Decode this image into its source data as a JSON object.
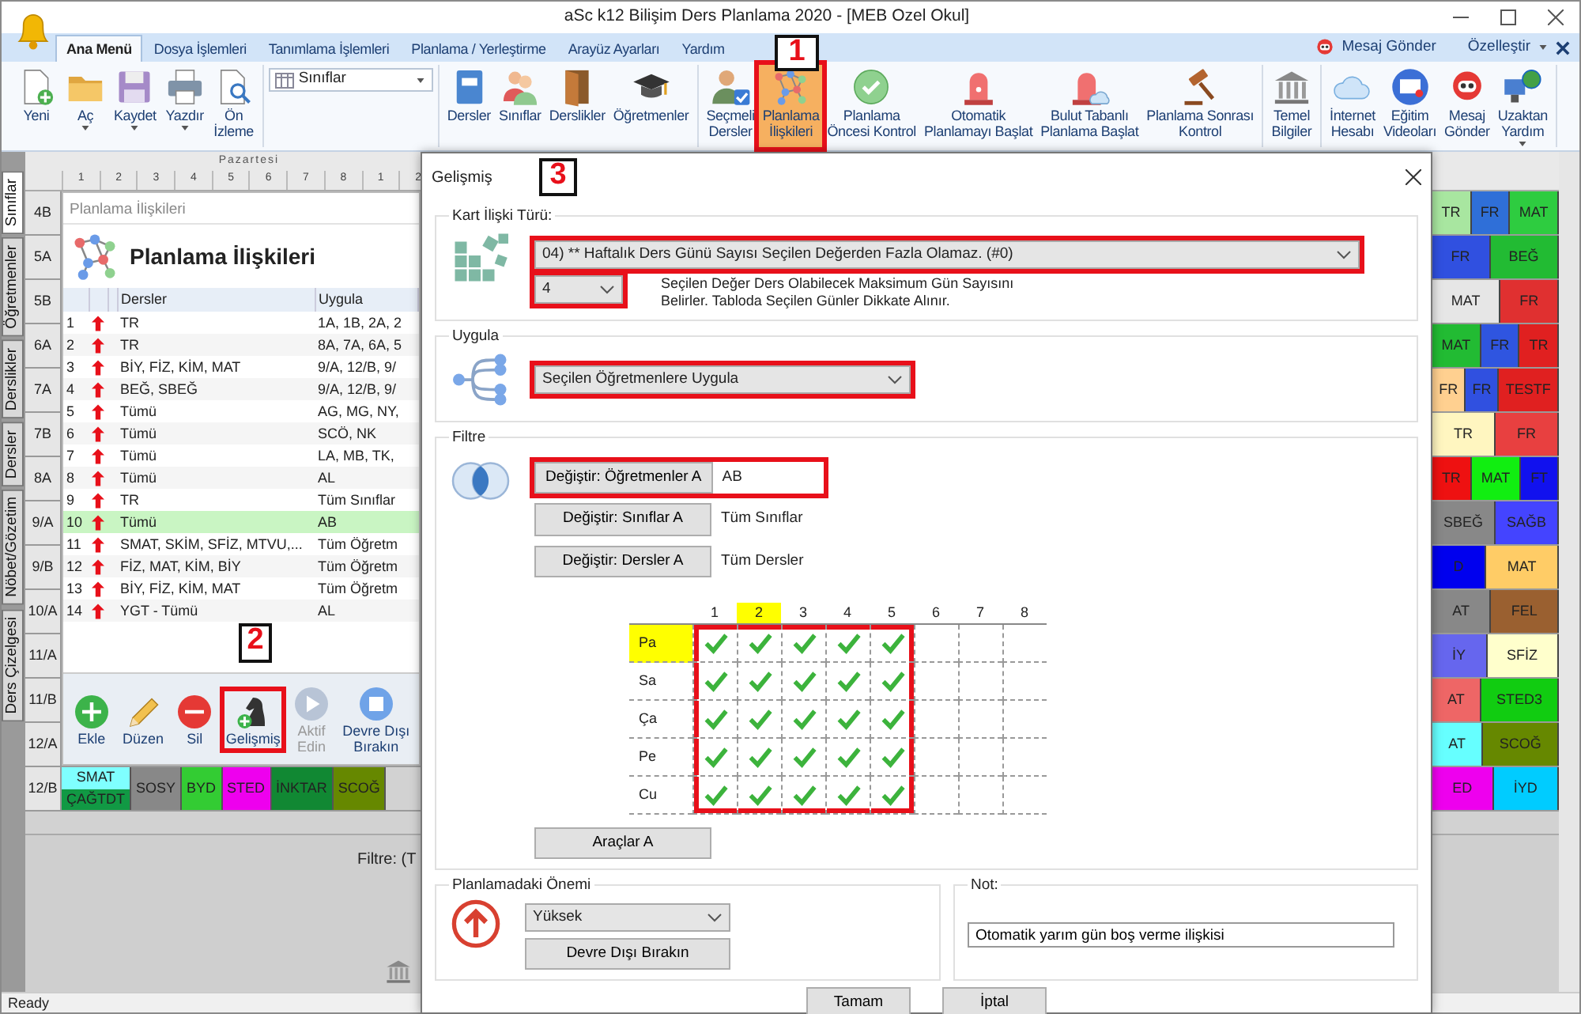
{
  "window": {
    "title": "aSc k12 Bilişim Ders Planlama 2020  - [MEB Ozel Okul]"
  },
  "menu_tabs": [
    {
      "label": "Ana Menü",
      "selected": true
    },
    {
      "label": "Dosya İşlemleri",
      "selected": false
    },
    {
      "label": "Tanımlama İşlemleri",
      "selected": false
    },
    {
      "label": "Planlama / Yerleştirme",
      "selected": false
    },
    {
      "label": "Arayüz Ayarları",
      "selected": false
    },
    {
      "label": "Yardım",
      "selected": false
    }
  ],
  "ribbon_extras": {
    "message": "Mesaj Gönder",
    "customize": "Özelleştir"
  },
  "ribbon": [
    {
      "kind": "buttons",
      "items": [
        {
          "label": "Yeni",
          "dropdown": false,
          "highlighted": false
        },
        {
          "label": "Aç",
          "dropdown": true,
          "highlighted": false
        },
        {
          "label": "Kaydet",
          "dropdown": true,
          "highlighted": false
        },
        {
          "label": "Yazdır",
          "dropdown": true,
          "highlighted": false
        },
        {
          "label": "Ön\nİzleme",
          "dropdown": false,
          "highlighted": false
        }
      ]
    },
    {
      "kind": "select",
      "value": "Sınıflar"
    },
    {
      "kind": "buttons",
      "items": [
        {
          "label": "Dersler",
          "dropdown": false,
          "highlighted": false
        },
        {
          "label": "Sınıflar",
          "dropdown": false,
          "highlighted": false
        },
        {
          "label": "Derslikler",
          "dropdown": false,
          "highlighted": false
        },
        {
          "label": "Öğretmenler",
          "dropdown": false,
          "highlighted": false
        }
      ]
    },
    {
      "kind": "buttons",
      "items": [
        {
          "label": "Seçmeli\nDersler",
          "dropdown": false,
          "highlighted": false
        },
        {
          "label": "Planlama\nİlişkileri",
          "dropdown": false,
          "highlighted": true
        },
        {
          "label": "Planlama\nÖncesi Kontrol",
          "dropdown": false,
          "highlighted": false
        },
        {
          "label": "Otomatik\nPlanlamayı Başlat",
          "dropdown": false,
          "highlighted": false
        },
        {
          "label": "Bulut Tabanlı\nPlanlama Başlat",
          "dropdown": false,
          "highlighted": false
        },
        {
          "label": "Planlama Sonrası\nKontrol",
          "dropdown": false,
          "highlighted": false
        }
      ]
    },
    {
      "kind": "buttons",
      "items": [
        {
          "label": "Temel\nBilgiler",
          "dropdown": false,
          "highlighted": false
        }
      ]
    },
    {
      "kind": "buttons",
      "items": [
        {
          "label": "İnternet\nHesabı",
          "dropdown": false,
          "highlighted": false
        },
        {
          "label": "Eğitim\nVideoları",
          "dropdown": false,
          "highlighted": false
        },
        {
          "label": "Mesaj\nGönder",
          "dropdown": false,
          "highlighted": false
        },
        {
          "label": "Uzaktan\nYardım",
          "dropdown": true,
          "highlighted": false
        }
      ]
    }
  ],
  "side_tabs": [
    {
      "label": "Sınıflar",
      "selected": true
    },
    {
      "label": "Öğretmenler",
      "selected": false
    },
    {
      "label": "Derslikler",
      "selected": false
    },
    {
      "label": "Dersler",
      "selected": false
    },
    {
      "label": "Nöbet/Gözetim",
      "selected": false
    },
    {
      "label": "Ders Çizelgesi",
      "selected": false
    }
  ],
  "timetable": {
    "day": "Pazartesi",
    "periods": [
      "1",
      "2",
      "3",
      "4",
      "5",
      "6",
      "7",
      "8",
      "1",
      "2"
    ],
    "rows": [
      {
        "class": "4B",
        "right_cards": [
          {
            "text": "TR",
            "color": "#a8e6a0"
          },
          {
            "text": "FR",
            "color": "#2f6fd8"
          },
          {
            "text": "MAT",
            "color": "#2ecc40"
          }
        ]
      },
      {
        "class": "5A",
        "right_cards": [
          {
            "text": "FR",
            "color": "#3050e0"
          },
          {
            "text": "BEĞ",
            "color": "#22bb33"
          }
        ]
      },
      {
        "class": "5B",
        "right_cards": [
          {
            "text": "MAT",
            "color": "#e6e6e6"
          },
          {
            "text": "FR",
            "color": "#e03030"
          }
        ]
      },
      {
        "class": "6A",
        "right_cards": [
          {
            "text": "MAT",
            "color": "#22bb33"
          },
          {
            "text": "FR",
            "color": "#2f55e0"
          },
          {
            "text": "TR",
            "color": "#e02020"
          }
        ]
      },
      {
        "class": "7A",
        "right_cards": [
          {
            "text": "FR",
            "color": "#ffd090"
          },
          {
            "text": "FR",
            "color": "#3050e0"
          },
          {
            "text": "TESTF",
            "color": "#e02020"
          }
        ]
      },
      {
        "class": "7B",
        "right_cards": [
          {
            "text": "TR",
            "color": "#fff6c0"
          },
          {
            "text": "FR",
            "color": "#e84040"
          }
        ]
      },
      {
        "class": "8A",
        "right_cards": [
          {
            "text": "TR",
            "color": "#ee1111"
          },
          {
            "text": "MAT",
            "color": "#11ee11"
          },
          {
            "text": "FT",
            "color": "#1111ee"
          }
        ]
      },
      {
        "class": "9/A",
        "right_cards": [
          {
            "text": "SBEĞ",
            "color": "#888888"
          },
          {
            "text": "SAĞB",
            "color": "#4444ff"
          }
        ]
      },
      {
        "class": "9/B",
        "right_cards": [
          {
            "text": "D",
            "color": "#0000ee"
          },
          {
            "text": "MAT",
            "color": "#ffcc66"
          }
        ]
      },
      {
        "class": "10/A",
        "right_cards": [
          {
            "text": "AT",
            "color": "#888888"
          },
          {
            "text": "FEL",
            "color": "#9a6030"
          }
        ]
      },
      {
        "class": "11/A",
        "right_cards": [
          {
            "text": "İY",
            "color": "#6666ee"
          },
          {
            "text": "SFİZ",
            "color": "#ffffcc"
          }
        ]
      },
      {
        "class": "11/B",
        "right_cards": [
          {
            "text": "AT",
            "color": "#ee6666"
          },
          {
            "text": "STED3",
            "color": "#11cc11"
          }
        ]
      },
      {
        "class": "12/A",
        "right_cards": [
          {
            "text": "AT",
            "color": "#66ffff"
          },
          {
            "text": "SCOĞ",
            "color": "#668800"
          }
        ]
      },
      {
        "class": "12/B",
        "left_slots": [
          [
            {
              "text": "SMAT",
              "color": "#7fffff"
            },
            {
              "text": "ÇAĞTDT",
              "color": "#119944"
            }
          ],
          [
            {
              "text": "SOSY",
              "color": "#888888"
            }
          ],
          [
            {
              "text": "BYD",
              "color": "#33cc33"
            }
          ],
          [
            {
              "text": "STED",
              "color": "#ee00ee"
            }
          ],
          [
            {
              "text": "İNKTAR",
              "color": "#118833"
            }
          ],
          [
            {
              "text": "SCOĞ",
              "color": "#668800"
            }
          ]
        ],
        "right_cards": [
          {
            "text": "ED",
            "color": "#ee00ee"
          },
          {
            "text": "İYD",
            "color": "#00ccff"
          }
        ]
      }
    ]
  },
  "relations_panel": {
    "caption": "Planlama İlişkileri",
    "title": "Planlama İlişkileri",
    "columns": [
      "Dersler",
      "Uygula"
    ],
    "rows": [
      {
        "no": "1",
        "lessons": "TR",
        "apply": "1A, 1B, 2A, 2",
        "selected": false
      },
      {
        "no": "2",
        "lessons": "TR",
        "apply": "8A, 7A, 6A, 5",
        "selected": false
      },
      {
        "no": "3",
        "lessons": "BİY, FİZ, KİM, MAT",
        "apply": "9/A, 12/B, 9/",
        "selected": false
      },
      {
        "no": "4",
        "lessons": "BEĞ, SBEĞ",
        "apply": "9/A, 12/B, 9/",
        "selected": false
      },
      {
        "no": "5",
        "lessons": "Tümü",
        "apply": "AG, MG, NY,",
        "selected": false
      },
      {
        "no": "6",
        "lessons": "Tümü",
        "apply": "SCÖ, NK",
        "selected": false
      },
      {
        "no": "7",
        "lessons": "Tümü",
        "apply": "LA, MB, TK,",
        "selected": false
      },
      {
        "no": "8",
        "lessons": "Tümü",
        "apply": "AL",
        "selected": false
      },
      {
        "no": "9",
        "lessons": "TR",
        "apply": "Tüm Sınıflar",
        "selected": false
      },
      {
        "no": "10",
        "lessons": "Tümü",
        "apply": "AB",
        "selected": true
      },
      {
        "no": "11",
        "lessons": "SMAT, SKİM, SFİZ, MTVU,...",
        "apply": "Tüm Öğretm",
        "selected": false
      },
      {
        "no": "12",
        "lessons": "FİZ, MAT, KİM, BİY",
        "apply": "Tüm Öğretm",
        "selected": false
      },
      {
        "no": "13",
        "lessons": "BİY, FİZ, KİM, MAT",
        "apply": "Tüm Öğretm",
        "selected": false
      },
      {
        "no": "14",
        "lessons": "YGT - Tümü",
        "apply": "AL",
        "selected": false
      }
    ],
    "toolbar": [
      {
        "label": "Ekle",
        "disabled": false,
        "highlighted": false
      },
      {
        "label": "Düzen",
        "disabled": false,
        "highlighted": false
      },
      {
        "label": "Sil",
        "disabled": false,
        "highlighted": false
      },
      {
        "label": "Gelişmiş",
        "disabled": false,
        "highlighted": true
      },
      {
        "label": "Aktif\nEdin",
        "disabled": true,
        "highlighted": false
      },
      {
        "label": "Devre Dışı\nBırakın",
        "disabled": false,
        "highlighted": false
      }
    ]
  },
  "bottom_panel": {
    "filter": "Filtre: (T"
  },
  "status_bar": {
    "text": "Ready"
  },
  "dialog": {
    "title": "Gelişmiş",
    "relation_type": {
      "legend": "Kart İlişki Türü:",
      "value": "04) ** Haftalık Ders Günü Sayısı Seçilen Değerden Fazla Olamaz. (#0)",
      "highlighted": true,
      "count": "4",
      "count_highlighted": true,
      "description": "Seçilen Değer Ders Olabilecek Maksimum Gün Sayısını\nBelirler. Tabloda Seçilen Günler Dikkate Alınır."
    },
    "apply": {
      "legend": "Uygula",
      "value": "Seçilen Öğretmenlere Uygula",
      "highlighted": true
    },
    "filter": {
      "legend": "Filtre",
      "rows": [
        {
          "button": "Değiştir: Öğretmenler A",
          "value": "AB",
          "highlighted": true
        },
        {
          "button": "Değiştir: Sınıflar A",
          "value": "Tüm Sınıflar",
          "highlighted": false
        },
        {
          "button": "Değiştir: Dersler A",
          "value": "Tüm Dersler",
          "highlighted": false
        }
      ],
      "periods": [
        {
          "label": "1",
          "selected": false
        },
        {
          "label": "2",
          "selected": true
        },
        {
          "label": "3",
          "selected": false
        },
        {
          "label": "4",
          "selected": false
        },
        {
          "label": "5",
          "selected": false
        },
        {
          "label": "6",
          "selected": false
        },
        {
          "label": "7",
          "selected": false
        },
        {
          "label": "8",
          "selected": false
        }
      ],
      "days": [
        {
          "label": "Pa",
          "selected": true,
          "checks": [
            true,
            true,
            true,
            true,
            true,
            false,
            false,
            false
          ]
        },
        {
          "label": "Sa",
          "selected": false,
          "checks": [
            true,
            true,
            true,
            true,
            true,
            false,
            false,
            false
          ]
        },
        {
          "label": "Ça",
          "selected": false,
          "checks": [
            true,
            true,
            true,
            true,
            true,
            false,
            false,
            false
          ]
        },
        {
          "label": "Pe",
          "selected": false,
          "checks": [
            true,
            true,
            true,
            true,
            true,
            false,
            false,
            false
          ]
        },
        {
          "label": "Cu",
          "selected": false,
          "checks": [
            true,
            true,
            true,
            true,
            true,
            false,
            false,
            false
          ]
        }
      ],
      "checks_highlighted": true,
      "tools_button": "Araçlar A"
    },
    "importance": {
      "legend": "Planlamadaki Önemi",
      "value": "Yüksek",
      "button": "Devre Dışı Bırakın"
    },
    "note": {
      "legend": "Not:",
      "value": "Otomatik yarım gün boş verme ilişkisi"
    },
    "buttons": [
      "Tamam",
      "İptal"
    ]
  },
  "annotations": [
    {
      "label": "1"
    },
    {
      "label": "2"
    },
    {
      "label": "3"
    }
  ]
}
